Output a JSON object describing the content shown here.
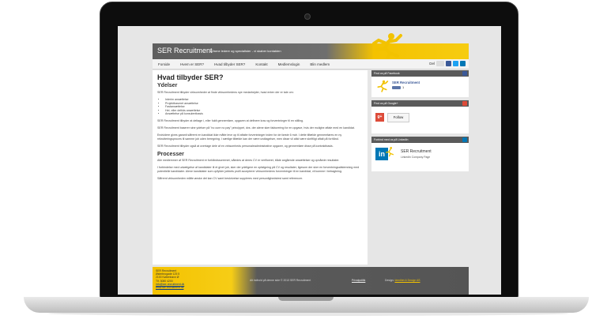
{
  "header": {
    "brand": "SER Recruitment",
    "tagline": "erfarne ledere og specialister - vi skaber kontakten"
  },
  "nav": {
    "items": [
      "Forside",
      "Hvem er SER?",
      "Hvad tilbyder SER?",
      "Kontakt",
      "Medlemslogin",
      "Blin medlem"
    ],
    "right_label": "Del"
  },
  "main": {
    "title": "Hvad tilbyder SER?",
    "section1": "Ydelser",
    "p1": "SER Recruitment tilbyder virksomheder at finde virksomhedens nye medarbejder, hvad enten der er tale om:",
    "bullets": [
      "Interim ansættelse",
      "Projektbaseret ansættelse",
      "Fastansættelse",
      "Hel- eller deltids ansættelse",
      "Ansættelse på konsulentbasis"
    ],
    "p2": "SER Recruitment tilbyder at deltage i, eller fuldt gennemføre, opgaven at definere krav og forventninger til en stilling.",
    "p3": "SER Recruitment baserer sine ydelser på \"no cure no pay\" princippet, dvs. der alene sker fakturering for en opgave, hvis der mulighe aftale med en kandidat.",
    "p4": "Endvidere gives garanti såfremt en kandidat ikke måtte leve op til aftalte forventninger inden for de første 6 mdr. I dette tilfælde gennemføres en ny rekrutteringsproces til samme job uden beregning. I særlige tilfælde kan der være undtagelser, men disse vil altid være skriftligt aftalt på forhånd.",
    "p5": "SER Recruitment tilbyder også at overtage dele af en virksomheds personaleadministrative opgaver, og gennemføre disse på kontraktbasis.",
    "section2": "Processer",
    "p6": "Alle medlemmer af SER Recruitment er forhåndsscreenet, således at deres CV er verificeret, både angående ansættelser og opnåede resultater.",
    "p7": "I forbindelse med udvælgelse af kandidater til et givet job, sker der ydeligere en opfølgning på CV og resultater, ligesom der sker en forventningsafstemning med potentielle kandidater. Alene kandidater som opfylder jobbets profil accepterer virksomhedens forventninger til en kandidat, vil komme i betragtning.",
    "p8": "Såfremt virksomheden måtte ønske det kan CV samt beskrivelse suppleres med personlighedstest samt referencer."
  },
  "sidebar": {
    "facebook": {
      "title": "Find os på Facebook",
      "name": "SER Recruitment",
      "like_count": "1"
    },
    "google": {
      "title": "Find os på Google+",
      "follow_label": "Follow"
    },
    "linkedin": {
      "title": "Forbind med os på LinkedIn",
      "name": "SER Recruitment",
      "subtitle": "LinkedIn Company Page"
    }
  },
  "footer": {
    "address_lines": [
      "SER Recruitment",
      "Østerbrogade 125 5",
      "2100 København Ø",
      "Tlf. 3080 4200"
    ],
    "email": "info@ser-recruitment.dk",
    "web": "www.ser-recruitment.dk",
    "copyright": "Alt indhold på denne side © 2013 SER Recruitment",
    "privacy": "Privatpolitik",
    "design_prefix": "Design:",
    "design_link": "Identitet & Design AS"
  },
  "colors": {
    "accent": "#f4c200",
    "dark": "#5a5a5a",
    "facebook": "#3b5998",
    "linkedin": "#0077b5",
    "google": "#dd4b39"
  }
}
